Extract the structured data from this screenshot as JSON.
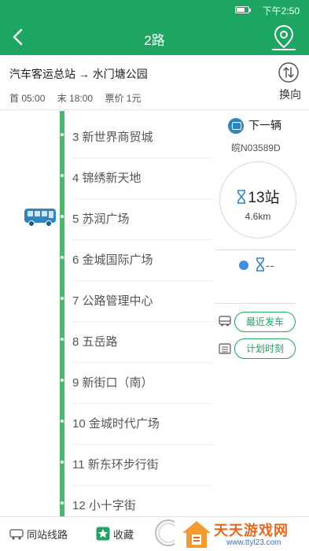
{
  "status_bar": {
    "time": "下午2:50",
    "battery_level": 0.7
  },
  "nav": {
    "title": "2路"
  },
  "route": {
    "name": "汽车客运总站 → 水门塘公园",
    "first_bus": "首 05:00",
    "last_bus": "末 18:00",
    "fare": "票价 1元",
    "swap_label": "换向"
  },
  "stops": [
    {
      "label": "3 新世界商贸城"
    },
    {
      "label": "4 锦绣新天地"
    },
    {
      "label": "5 苏润广场"
    },
    {
      "label": "6 金城国际广场"
    },
    {
      "label": "7 公路管理中心"
    },
    {
      "label": "8 五岳路"
    },
    {
      "label": "9 新街口（南）"
    },
    {
      "label": "10 金城时代广场"
    },
    {
      "label": "11 新东环步行街"
    },
    {
      "label": "12 小十字街"
    }
  ],
  "side": {
    "next_bus_label": "下一辆",
    "plate": "皖N03589D",
    "stations": "13站",
    "distance": "4.6km",
    "second_bus_eta": "--",
    "recent_departure_label": "最近发车",
    "schedule_label": "计划时刻"
  },
  "bottom": {
    "same_station_label": "同站线路",
    "favorite_label": "收藏"
  },
  "watermark": {
    "title": "天天游戏网",
    "url": "www.ttyl23.com"
  },
  "colors": {
    "brand_green": "#1fa562",
    "route_line": "#4cb86d",
    "badge_blue": "#2e86c1"
  }
}
